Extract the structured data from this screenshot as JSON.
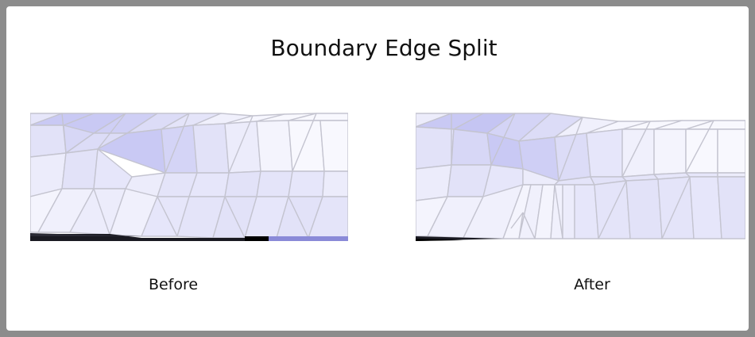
{
  "title": "Boundary Edge Split",
  "panels": {
    "before": {
      "caption": "Before"
    },
    "after": {
      "caption": "After"
    }
  },
  "colors": {
    "mesh_fill_dark": "#c9c9f4",
    "mesh_fill_mid": "#dcdcf7",
    "mesh_fill_light": "#ececfb",
    "mesh_fill_white": "#f8f8fe",
    "edge": "#c4c4d0",
    "boundary_dark": "#1a1a22",
    "boundary_blue": "#8a8ad8"
  }
}
